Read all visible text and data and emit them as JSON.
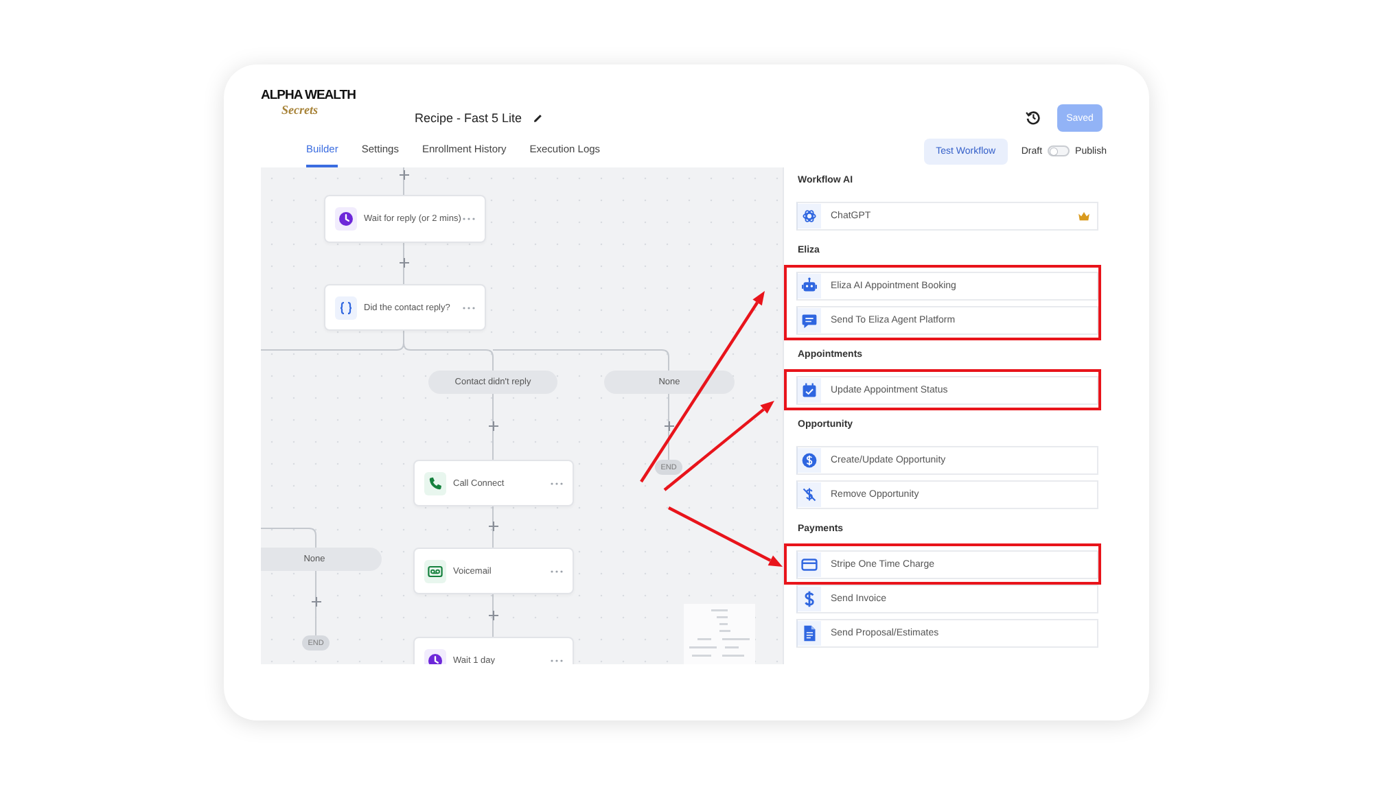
{
  "logo": {
    "name": "ALPHA WEALTH",
    "tagline": "Secrets"
  },
  "header": {
    "title": "Recipe - Fast 5 Lite",
    "save_button": "Saved"
  },
  "tabs": [
    {
      "label": "Builder",
      "selected": true
    },
    {
      "label": "Settings",
      "selected": false
    },
    {
      "label": "Enrollment History",
      "selected": false
    },
    {
      "label": "Execution Logs",
      "selected": false
    }
  ],
  "toolbar": {
    "test_button": "Test Workflow",
    "draft_label": "Draft",
    "publish_label": "Publish",
    "published": false
  },
  "canvas": {
    "nodes": [
      {
        "kind": "wait_reply",
        "label": "Wait for reply (or 2 mins)"
      },
      {
        "kind": "condition",
        "label": "Did the contact reply?"
      },
      {
        "kind": "call",
        "label": "Call Connect"
      },
      {
        "kind": "voicemail",
        "label": "Voicemail"
      },
      {
        "kind": "delay",
        "label": "Wait 1 day"
      }
    ],
    "branches": [
      {
        "label": "Contact didn't reply"
      },
      {
        "label": "None"
      },
      {
        "label": "None"
      }
    ],
    "end_markers": [
      "END",
      "END"
    ]
  },
  "actions_panel": {
    "sections": [
      {
        "title": "Workflow AI",
        "items": [
          {
            "kind": "ai",
            "label": "ChatGPT",
            "premium": true,
            "highlighted": false
          }
        ]
      },
      {
        "title": "Eliza",
        "items": [
          {
            "kind": "booking",
            "label": "Eliza AI Appointment Booking",
            "premium": false,
            "highlighted": true
          },
          {
            "kind": "message",
            "label": "Send To Eliza Agent Platform",
            "premium": false,
            "highlighted": true
          }
        ]
      },
      {
        "title": "Appointments",
        "items": [
          {
            "kind": "status",
            "label": "Update Appointment Status",
            "premium": false,
            "highlighted": true
          }
        ]
      },
      {
        "title": "Opportunity",
        "items": [
          {
            "kind": "opportunity",
            "label": "Create/Update Opportunity",
            "premium": false,
            "highlighted": false
          },
          {
            "kind": "remove",
            "label": "Remove Opportunity",
            "premium": false,
            "highlighted": false
          }
        ]
      },
      {
        "title": "Payments",
        "items": [
          {
            "kind": "charge",
            "label": "Stripe One Time Charge",
            "premium": false,
            "highlighted": true
          },
          {
            "kind": "invoice",
            "label": "Send Invoice",
            "premium": false,
            "highlighted": false
          },
          {
            "kind": "proposal",
            "label": "Send Proposal/Estimates",
            "premium": false,
            "highlighted": false
          }
        ]
      }
    ]
  }
}
